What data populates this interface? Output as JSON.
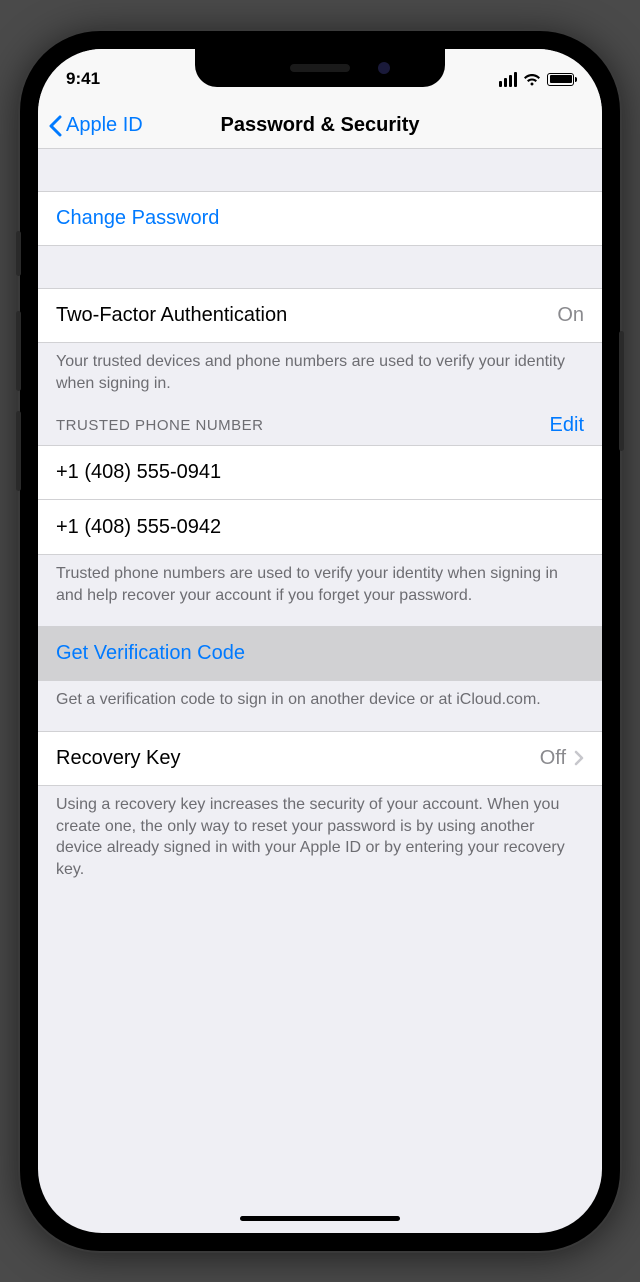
{
  "status": {
    "time": "9:41"
  },
  "nav": {
    "back": "Apple ID",
    "title": "Password & Security"
  },
  "changePassword": {
    "label": "Change Password"
  },
  "twoFactor": {
    "label": "Two-Factor Authentication",
    "value": "On",
    "footer": "Your trusted devices and phone numbers are used to verify your identity when signing in."
  },
  "trustedPhones": {
    "header": "TRUSTED PHONE NUMBER",
    "edit": "Edit",
    "numbers": [
      "+1 (408) 555-0941",
      "+1 (408) 555-0942"
    ],
    "footer": "Trusted phone numbers are used to verify your identity when signing in and help recover your account if you forget your password."
  },
  "verificationCode": {
    "label": "Get Verification Code",
    "footer": "Get a verification code to sign in on another device or at iCloud.com."
  },
  "recoveryKey": {
    "label": "Recovery Key",
    "value": "Off",
    "footer": "Using a recovery key increases the security of your account. When you create one, the only way to reset your password is by using another device already signed in with your Apple ID or by entering your recovery key."
  }
}
